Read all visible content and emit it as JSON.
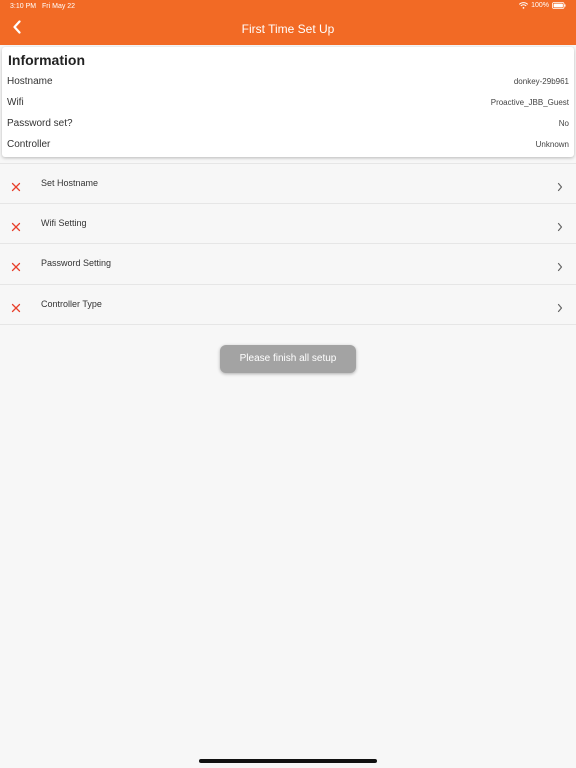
{
  "status_bar": {
    "time": "3:10 PM",
    "date": "Fri May 22",
    "battery": "100%",
    "icons": [
      "wifi-icon",
      "battery-icon"
    ]
  },
  "nav": {
    "title": "First Time Set Up",
    "back_icon": "chevron-left-icon"
  },
  "info": {
    "title": "Information",
    "rows": [
      {
        "label": "Hostname",
        "value": "donkey-29b961"
      },
      {
        "label": "Wifi",
        "value": "Proactive_JBB_Guest"
      },
      {
        "label": "Password set?",
        "value": "No"
      },
      {
        "label": "Controller",
        "value": "Unknown"
      }
    ]
  },
  "settings": [
    {
      "label": "Set Hostname",
      "status_icon": "x-icon",
      "done": false
    },
    {
      "label": "Wifi Setting",
      "status_icon": "x-icon",
      "done": false
    },
    {
      "label": "Password Setting",
      "status_icon": "x-icon",
      "done": false
    },
    {
      "label": "Controller Type",
      "status_icon": "x-icon",
      "done": false
    }
  ],
  "toast": {
    "message": "Please finish all setup"
  },
  "colors": {
    "accent": "#f26a25",
    "error_x": "#e8402b",
    "toast_bg": "#a3a3a3",
    "background": "#f7f7f7"
  }
}
